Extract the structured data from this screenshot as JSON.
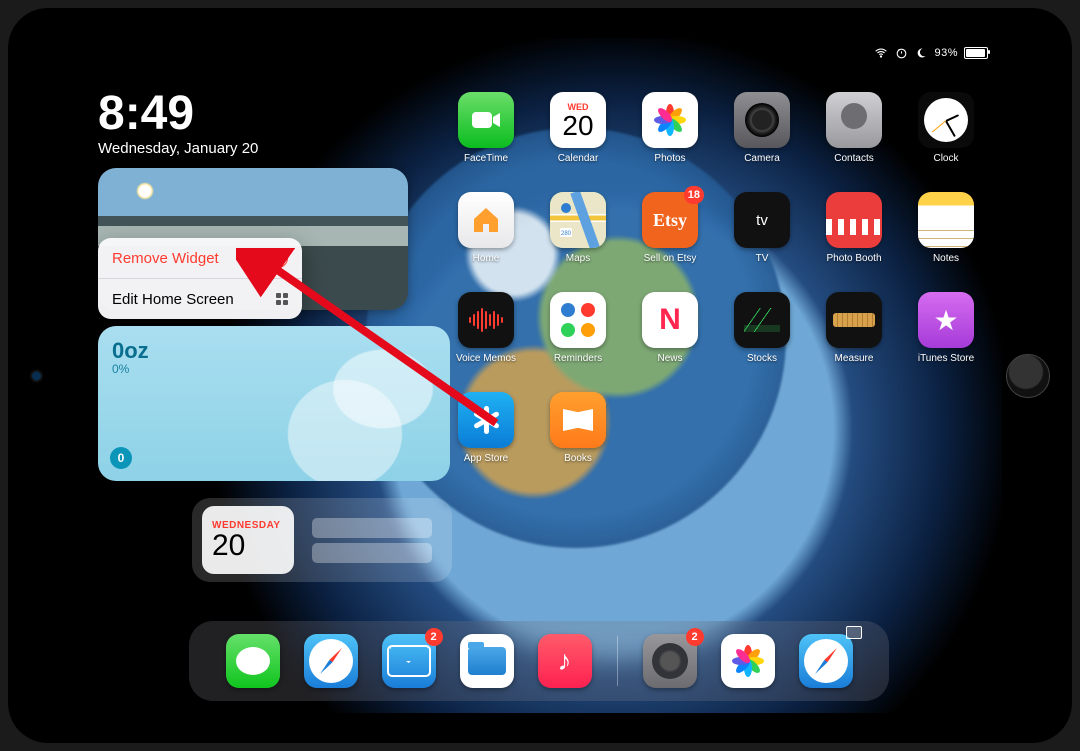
{
  "status": {
    "wifi_icon": "wifi",
    "orientation_lock_icon": "orientation-lock",
    "dnd_icon": "moon",
    "battery_pct": "93%",
    "battery_fill": 0.93
  },
  "clock": {
    "time": "8:49",
    "date": "Wednesday, January 20"
  },
  "context_menu": {
    "remove": "Remove Widget",
    "edit": "Edit Home Screen"
  },
  "widgets": {
    "water": {
      "amount": "0oz",
      "percent": "0%",
      "streak": "0"
    },
    "calendar": {
      "dow": "WEDNESDAY",
      "day": "20"
    }
  },
  "apps": {
    "row1": [
      {
        "id": "facetime",
        "label": "FaceTime"
      },
      {
        "id": "calendar",
        "label": "Calendar",
        "dow": "WED",
        "day": "20"
      },
      {
        "id": "photos",
        "label": "Photos"
      },
      {
        "id": "camera",
        "label": "Camera"
      },
      {
        "id": "contacts",
        "label": "Contacts"
      },
      {
        "id": "clock",
        "label": "Clock"
      }
    ],
    "row2": [
      {
        "id": "home",
        "label": "Home"
      },
      {
        "id": "maps",
        "label": "Maps"
      },
      {
        "id": "etsy",
        "label": "Sell on Etsy",
        "glyph": "Etsy",
        "badge": "18"
      },
      {
        "id": "tv",
        "label": "TV",
        "glyph": "tv"
      },
      {
        "id": "pb",
        "label": "Photo Booth"
      },
      {
        "id": "notes",
        "label": "Notes"
      }
    ],
    "row3": [
      {
        "id": "vm",
        "label": "Voice Memos"
      },
      {
        "id": "rem",
        "label": "Reminders"
      },
      {
        "id": "news",
        "label": "News",
        "glyph": "N"
      },
      {
        "id": "stocks",
        "label": "Stocks"
      },
      {
        "id": "measure",
        "label": "Measure"
      },
      {
        "id": "itunes",
        "label": "iTunes Store"
      }
    ],
    "row4": [
      {
        "id": "appstore",
        "label": "App Store"
      },
      {
        "id": "books",
        "label": "Books"
      }
    ]
  },
  "dock": {
    "left": [
      {
        "id": "messages",
        "label": "Messages"
      },
      {
        "id": "safari",
        "label": "Safari"
      },
      {
        "id": "mail",
        "label": "Mail",
        "badge": "2"
      },
      {
        "id": "files",
        "label": "Files"
      },
      {
        "id": "music",
        "label": "Music"
      }
    ],
    "right": [
      {
        "id": "settings",
        "label": "Settings",
        "badge": "2"
      },
      {
        "id": "photos",
        "label": "Photos"
      },
      {
        "id": "safari2",
        "label": "Safari"
      }
    ]
  },
  "petal_colors": [
    "#ff3b30",
    "#ff9f0a",
    "#ffd60a",
    "#30d158",
    "#0fb6ff",
    "#0a84ff",
    "#5e5ce6",
    "#ff2d92"
  ]
}
